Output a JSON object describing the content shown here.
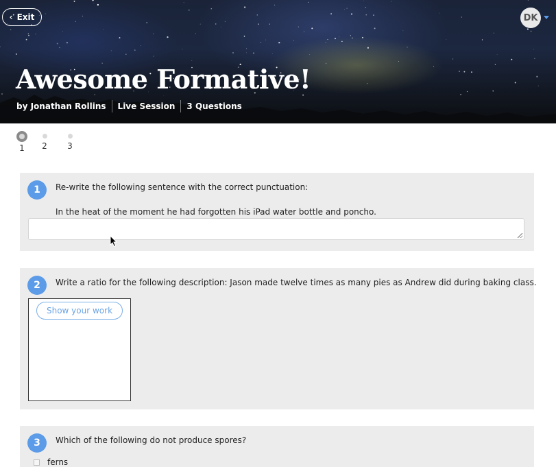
{
  "header": {
    "exit_label": "Exit",
    "avatar_initials": "DK",
    "title": "Awesome Formative!",
    "meta": [
      "by Jonathan Rollins",
      "Live Session",
      "3 Questions"
    ]
  },
  "progress": {
    "steps": [
      "1",
      "2",
      "3"
    ],
    "current": 1
  },
  "questions": [
    {
      "number": "1",
      "prompt_line1": "Re-write the following sentence with the correct punctuation:",
      "prompt_line2": "In the heat of the moment he had forgotten his iPad water bottle and poncho.",
      "answer_value": ""
    },
    {
      "number": "2",
      "prompt": "Write a ratio for the following description: Jason made twelve times as many pies as Andrew did during baking class.",
      "work_button": "Show your work"
    },
    {
      "number": "3",
      "prompt": "Which of the following do not produce spores?",
      "choices": [
        "ferns"
      ]
    }
  ],
  "colors": {
    "accent": "#5b9be8",
    "card_bg": "#ececec"
  }
}
